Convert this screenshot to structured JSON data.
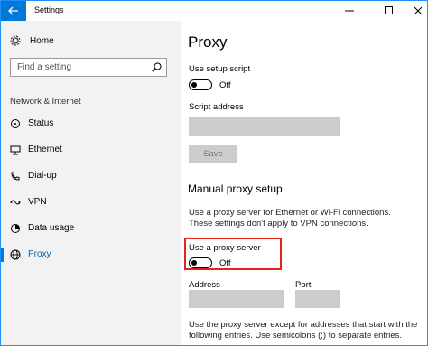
{
  "window": {
    "title": "Settings",
    "controls": [
      "minimize",
      "maximize",
      "close"
    ]
  },
  "sidebar": {
    "home_label": "Home",
    "search_placeholder": "Find a setting",
    "section_label": "Network & Internet",
    "items": [
      {
        "label": "Status",
        "icon": "status-icon",
        "active": false
      },
      {
        "label": "Ethernet",
        "icon": "ethernet-icon",
        "active": false
      },
      {
        "label": "Dial-up",
        "icon": "dial-up-icon",
        "active": false
      },
      {
        "label": "VPN",
        "icon": "vpn-icon",
        "active": false
      },
      {
        "label": "Data usage",
        "icon": "data-usage-icon",
        "active": false
      },
      {
        "label": "Proxy",
        "icon": "globe-icon",
        "active": true
      }
    ]
  },
  "main": {
    "title": "Proxy",
    "setup_script_label": "Use setup script",
    "setup_script_state": "Off",
    "script_address_label": "Script address",
    "save_label": "Save",
    "manual_title": "Manual proxy setup",
    "manual_description": "Use a proxy server for Ethernet or Wi-Fi connections. These settings don't apply to VPN connections.",
    "use_proxy_label": "Use a proxy server",
    "use_proxy_state": "Off",
    "address_label": "Address",
    "port_label": "Port",
    "exceptions_text": "Use the proxy server except for addresses that start with the following entries. Use semicolons (;) to separate entries."
  },
  "colors": {
    "accent": "#0078d7",
    "highlight": "#e5231b",
    "sidebar_bg": "#f2f2f2",
    "disabled_field": "#cccccc"
  }
}
